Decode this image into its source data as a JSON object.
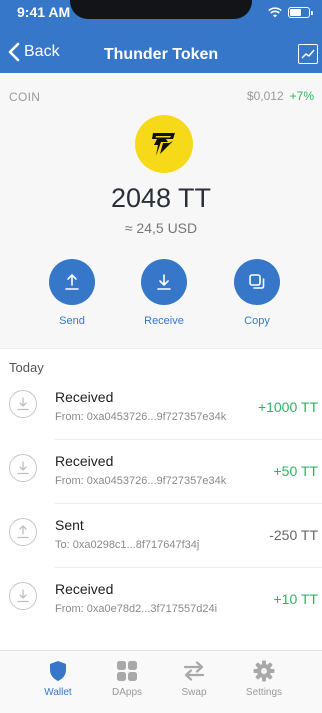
{
  "status": {
    "time": "9:41 AM"
  },
  "nav": {
    "back_label": "Back",
    "title": "Thunder Token"
  },
  "coin": {
    "label": "COIN",
    "price": "$0,012",
    "change": "+7%",
    "balance": "2048 TT",
    "balance_usd": "≈ 24,5 USD"
  },
  "actions": {
    "send": "Send",
    "receive": "Receive",
    "copy": "Copy"
  },
  "transactions": {
    "section_title": "Today",
    "items": [
      {
        "type": "Received",
        "address": "From: 0xa0453726...9f727357e34k",
        "amount": "+1000 TT",
        "icon": "receive-icon"
      },
      {
        "type": "Received",
        "address": "From: 0xa0453726...9f727357e34k",
        "amount": "+50 TT",
        "icon": "receive-icon"
      },
      {
        "type": "Sent",
        "address": "To: 0xa0298c1...8f717647f34j",
        "amount": "-250 TT",
        "icon": "send-icon"
      },
      {
        "type": "Received",
        "address": "From: 0xa0e78d2...3f717557d24i",
        "amount": "+10 TT",
        "icon": "receive-icon"
      }
    ]
  },
  "tabs": [
    {
      "label": "Wallet",
      "icon": "shield-icon",
      "active": true
    },
    {
      "label": "DApps",
      "icon": "grid-icon",
      "active": false
    },
    {
      "label": "Swap",
      "icon": "swap-icon",
      "active": false
    },
    {
      "label": "Settings",
      "icon": "gear-icon",
      "active": false
    }
  ],
  "colors": {
    "brand_blue": "#3677c9",
    "positive_green": "#2db55d",
    "token_yellow": "#f6d918"
  }
}
